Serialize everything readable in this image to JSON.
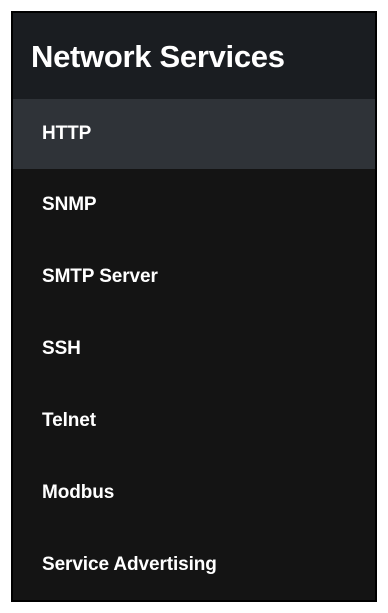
{
  "panel": {
    "title": "Network Services",
    "items": [
      {
        "label": "HTTP",
        "active": true
      },
      {
        "label": "SNMP",
        "active": false
      },
      {
        "label": "SMTP Server",
        "active": false
      },
      {
        "label": "SSH",
        "active": false
      },
      {
        "label": "Telnet",
        "active": false
      },
      {
        "label": "Modbus",
        "active": false
      },
      {
        "label": "Service Advertising",
        "active": false
      }
    ]
  },
  "colors": {
    "panel_background": "#141414",
    "header_background": "#1a1d21",
    "active_item_background": "#2f3338",
    "text": "#ffffff"
  }
}
